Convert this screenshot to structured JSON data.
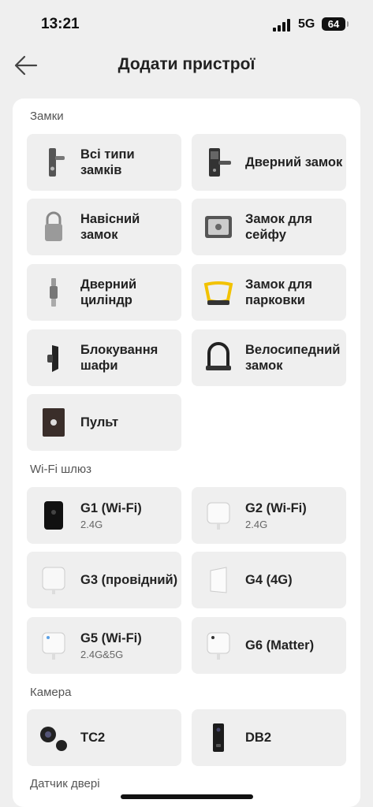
{
  "status_bar": {
    "time": "13:21",
    "network": "5G",
    "battery": "64"
  },
  "header": {
    "title": "Додати пристрої"
  },
  "sections": {
    "locks": {
      "title": "Замки",
      "items": [
        {
          "title": "Всі типи замків",
          "icon": "lock-all-icon"
        },
        {
          "title": "Дверний замок",
          "icon": "door-lock-icon"
        },
        {
          "title": "Навісний замок",
          "icon": "padlock-icon"
        },
        {
          "title": "Замок для сейфу",
          "icon": "safe-icon"
        },
        {
          "title": "Дверний циліндр",
          "icon": "cylinder-icon"
        },
        {
          "title": "Замок для парковки",
          "icon": "parking-lock-icon"
        },
        {
          "title": "Блокування шафи",
          "icon": "cabinet-lock-icon"
        },
        {
          "title": "Велосипедний замок",
          "icon": "bike-lock-icon"
        },
        {
          "title": "Пульт",
          "icon": "remote-icon"
        }
      ]
    },
    "gateways": {
      "title": "Wi-Fi шлюз",
      "items": [
        {
          "title": "G1 (Wi-Fi)",
          "subtitle": "2.4G",
          "icon": "gateway-g1-icon"
        },
        {
          "title": "G2 (Wi-Fi)",
          "subtitle": "2.4G",
          "icon": "gateway-g2-icon"
        },
        {
          "title": "G3 (провідний)",
          "icon": "gateway-g3-icon"
        },
        {
          "title": "G4 (4G)",
          "icon": "gateway-g4-icon"
        },
        {
          "title": "G5 (Wi-Fi)",
          "subtitle": "2.4G&5G",
          "icon": "gateway-g5-icon"
        },
        {
          "title": "G6 (Matter)",
          "icon": "gateway-g6-icon"
        }
      ]
    },
    "camera": {
      "title": "Камера",
      "items": [
        {
          "title": "TC2",
          "icon": "camera-tc2-icon"
        },
        {
          "title": "DB2",
          "icon": "doorbell-db2-icon"
        }
      ]
    },
    "door_sensor": {
      "title": "Датчик двері"
    }
  }
}
